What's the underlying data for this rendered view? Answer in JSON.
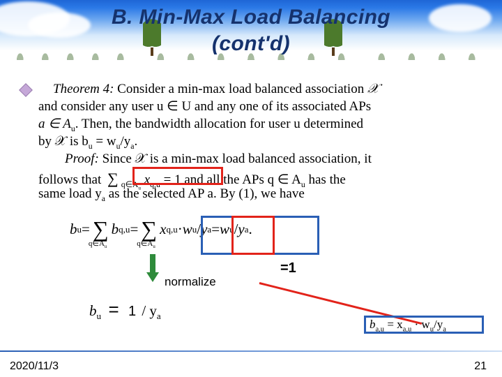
{
  "title": {
    "line1": "B. Min-Max Load Balancing",
    "line2": "(cont'd)"
  },
  "theorem": {
    "label": "Theorem 4:",
    "l1a": "Consider a min-max load balanced association ",
    "Xsym": "𝒳",
    "l2": "and consider any user u ∈ U and any one of its associated APs",
    "l3a": "a ∈ A",
    "l3sub": "u",
    "l3b": ". Then, the bandwidth allocation for user u determined",
    "l4a": "by 𝒳 is b",
    "l4sub": "u",
    "l4b": " = w",
    "l4sub2": "u",
    "l4c": "/y",
    "l4sub3": "a",
    "l4d": "."
  },
  "proof": {
    "label": "Proof:",
    "l1": "Since 𝒳 is a min-max load balanced association, it",
    "l2a": "follows that ",
    "sumtxt": "∑",
    "suml": "q∈A",
    "sumidx": "u",
    "sumbody": " x",
    "sumsub": "q,u",
    "sumeq": " = 1",
    "l2b": " and all the APs q ∈ A",
    "l2bsub": "u",
    "l2c": " has the",
    "l3a": "same load y",
    "l3sub": "a",
    "l3b": " as the selected AP a. By (1), we have"
  },
  "eq": {
    "lhs": "b",
    "lhs_sub": "u",
    "sum": "∑",
    "sum_sub": "q∈A",
    "sum_subidx": "u",
    "b": "b",
    "b_sub": "q,u",
    "x": "x",
    "x_sub": "q,u",
    "mult": " · ",
    "w": "w",
    "w_sub": "u",
    "slash": "/",
    "y": "y",
    "y_sub": "a",
    "eq": " = ",
    "dot": "."
  },
  "labels": {
    "normalize": "normalize",
    "eq1": "=1",
    "bigeq": "=",
    "one": "1"
  },
  "eq2": {
    "b": "b",
    "b_sub": "u",
    "slash": "/ y",
    "y_sub": "a"
  },
  "ba": {
    "text1": "b",
    "s1": "a,u",
    "eq": " = x",
    "s2": "a,u",
    "mid": " · w",
    "s3": "u",
    "tail": "/y",
    "s4": "a"
  },
  "footer": {
    "date": "2020/11/3",
    "page": "21"
  }
}
